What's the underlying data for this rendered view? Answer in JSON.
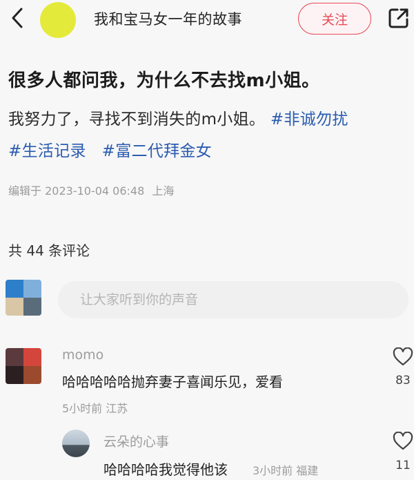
{
  "header": {
    "author_title": "我和宝马女一年的故事",
    "follow_label": "关注",
    "back_icon": "chevron-left-icon",
    "share_icon": "share-icon",
    "avatar_color": "#e4ea3a"
  },
  "post": {
    "title": "很多人都问我，为什么不去找m小姐。",
    "body": "我努力了，寻找不到消失的m小姐。",
    "tags": [
      "#非诚勿扰",
      "#生活记录",
      "#富二代拜金女"
    ],
    "edited_label": "编辑于",
    "datetime": "2023-10-04 06:48",
    "location": "上海"
  },
  "comments_section": {
    "count_label": "共 44 条评论",
    "input_placeholder": "让大家听到你的声音"
  },
  "comments": [
    {
      "author": "momo",
      "text": "哈哈哈哈哈抛弃妻子喜闻乐见，爱看",
      "time": "5小时前",
      "location": "江苏",
      "likes": "83",
      "reply": {
        "author": "云朵的心事",
        "text": "哈哈哈哈我觉得他该",
        "time": "3小时前",
        "location": "福建",
        "likes": "11"
      }
    }
  ],
  "colors": {
    "accent": "#e94a57",
    "tag": "#2b5cb0",
    "muted": "#9c9c9c"
  }
}
